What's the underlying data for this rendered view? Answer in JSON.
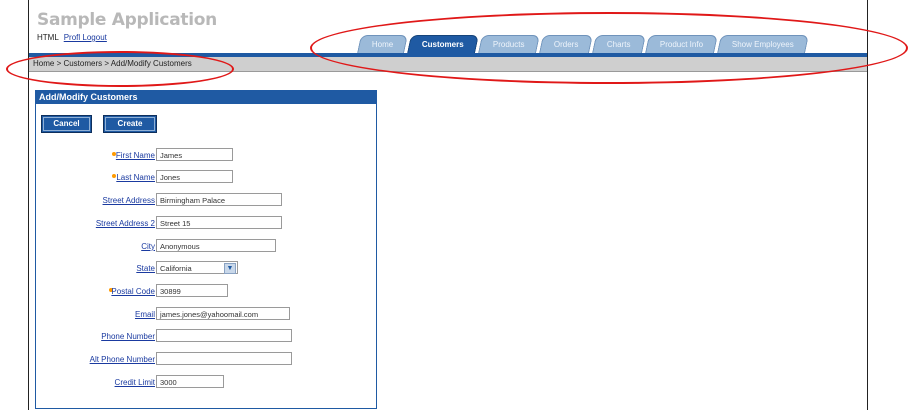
{
  "app": {
    "title": "Sample Application",
    "user": "HTML",
    "logout": "Profl Logout"
  },
  "tabs": [
    "Home",
    "Customers",
    "Products",
    "Orders",
    "Charts",
    "Product Info",
    "Show Employees"
  ],
  "active_tab": 1,
  "breadcrumb": "Home > Customers > Add/Modify Customers",
  "panel": {
    "title": "Add/Modify Customers",
    "cancel": "Cancel",
    "create": "Create"
  },
  "fields": {
    "first_name": {
      "label": "First Name",
      "value": "James"
    },
    "last_name": {
      "label": "Last Name",
      "value": "Jones"
    },
    "street1": {
      "label": "Street Address",
      "value": "Birmingham Palace"
    },
    "street2": {
      "label": "Street Address 2",
      "value": "Street 15"
    },
    "city": {
      "label": "City",
      "value": "Anonymous"
    },
    "state": {
      "label": "State",
      "value": "California"
    },
    "postal": {
      "label": "Postal Code",
      "value": "30899"
    },
    "email": {
      "label": "Email",
      "value": "james.jones@yahoomail.com"
    },
    "phone": {
      "label": "Phone Number",
      "value": ""
    },
    "alt_phone": {
      "label": "Alt Phone Number",
      "value": ""
    },
    "credit": {
      "label": "Credit Limit",
      "value": "3000"
    }
  },
  "colors": {
    "accent": "#1f5aa3",
    "annotation": "#e01818",
    "required": "#ff9a00"
  }
}
